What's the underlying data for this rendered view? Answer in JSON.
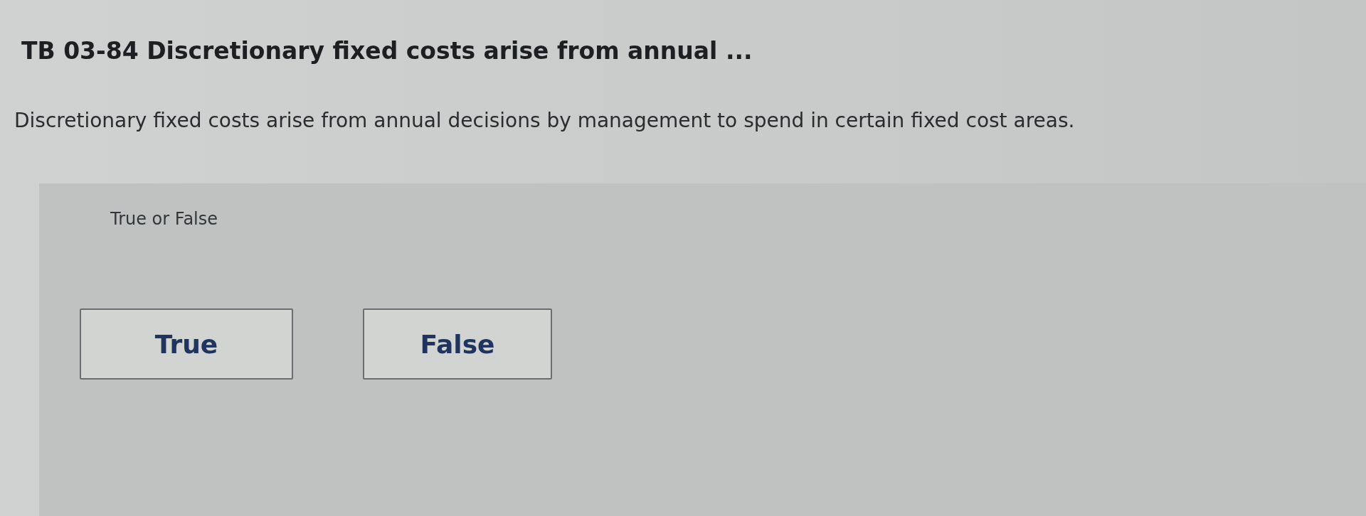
{
  "question": {
    "title": "TB 03-84 Discretionary fixed costs arise from annual ...",
    "text": "Discretionary fixed costs arise from annual decisions by management to spend in certain fixed cost areas."
  },
  "answer_panel": {
    "label": "True or False",
    "options": [
      {
        "label": "True",
        "selected": false
      },
      {
        "label": "False",
        "selected": false
      }
    ]
  }
}
